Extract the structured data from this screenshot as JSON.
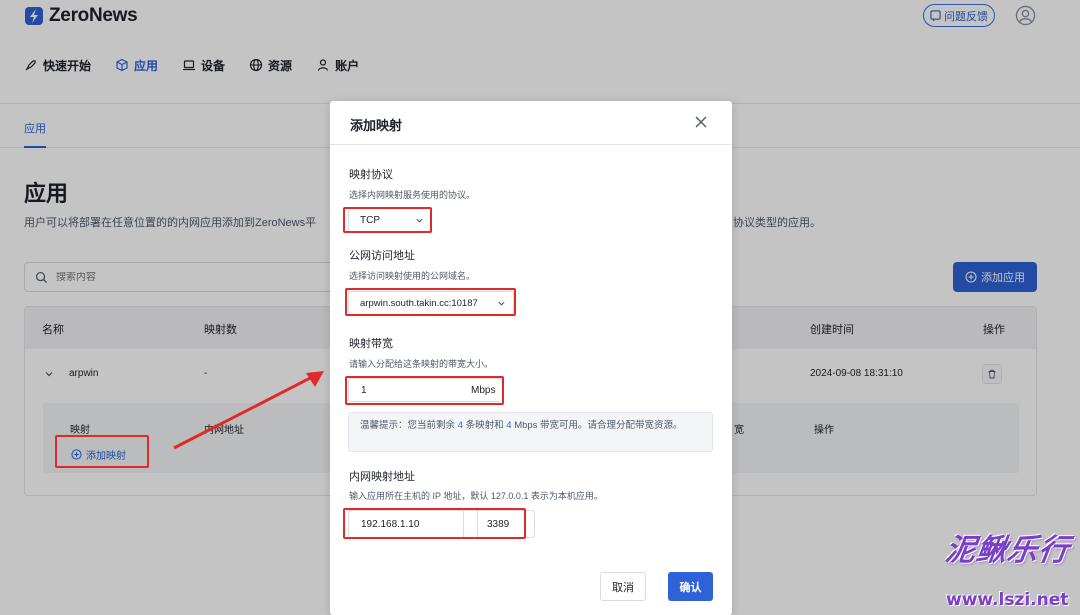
{
  "app": {
    "logo_text": "ZeroNews",
    "feedback_label": "问题反馈"
  },
  "nav": {
    "items": [
      {
        "label": "快速开始",
        "icon": "rocket-icon"
      },
      {
        "label": "应用",
        "icon": "cube-icon",
        "active": true
      },
      {
        "label": "设备",
        "icon": "laptop-icon"
      },
      {
        "label": "资源",
        "icon": "globe-icon"
      },
      {
        "label": "账户",
        "icon": "user-icon"
      }
    ]
  },
  "subnav": {
    "tab": "应用"
  },
  "page": {
    "title": "应用",
    "description": "用户可以将部署在任意位置的的内网应用添加到ZeroNews平",
    "description_tail": "协议类型的应用。",
    "search_placeholder": "搜索内容",
    "add_app_label": "添加应用"
  },
  "table": {
    "headers": {
      "name": "名称",
      "mapping_count": "映射数",
      "created_at": "创建时间",
      "actions": "操作"
    },
    "row": {
      "name": "arpwin",
      "mapping_count": "-",
      "created_at": "2024-09-08 18:31:10"
    },
    "subpanel": {
      "mapping_label": "映射",
      "internal_addr_label": "内网地址",
      "bandwidth_tail": "宽",
      "actions_label": "操作",
      "add_mapping_label": "添加映射"
    }
  },
  "modal": {
    "title": "添加映射",
    "protocol": {
      "label": "映射协议",
      "hint": "选择内网映射服务使用的协议。",
      "value": "TCP"
    },
    "domain": {
      "label": "公网访问地址",
      "hint": "选择访问映射使用的公网域名。",
      "value": "arpwin.south.takin.cc:10187"
    },
    "bandwidth": {
      "label": "映射带宽",
      "hint": "请输入分配给这条映射的带宽大小。",
      "value": "1",
      "unit": "Mbps"
    },
    "tip": {
      "prefix": "温馨提示：您当前剩余",
      "remaining_mappings": "4",
      "mid1": "条映射和",
      "remaining_bandwidth": "4",
      "mid2": "Mbps 带宽可用。请合理分配带宽资源。"
    },
    "internal": {
      "label": "内网映射地址",
      "hint": "输入应用所在主机的 IP 地址，默认 127.0.0.1 表示为本机应用。",
      "ip": "192.168.1.10",
      "port": "3389"
    },
    "cancel_label": "取消",
    "confirm_label": "确认"
  },
  "watermark": {
    "line1": "泥鳅乐行",
    "line2": "www.lszi.net"
  },
  "colors": {
    "accent": "#2f62d6",
    "highlight": "#e02a2a",
    "watermark": "#7a3fc7"
  }
}
